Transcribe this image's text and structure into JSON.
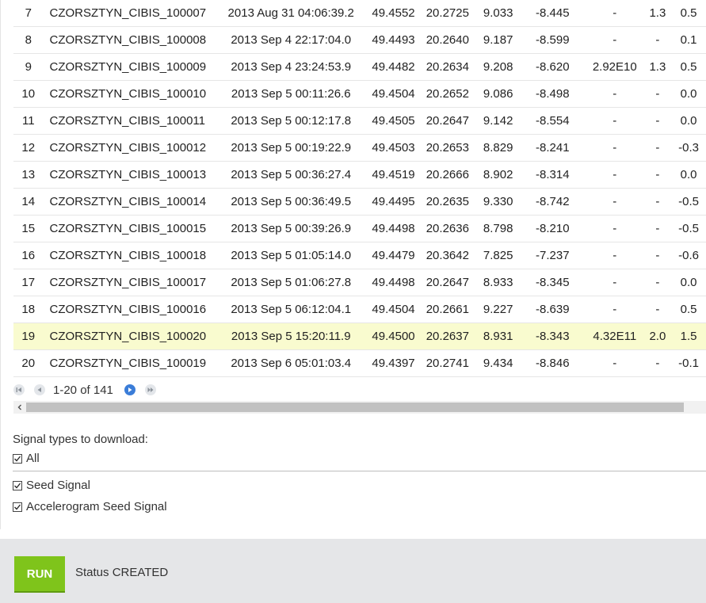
{
  "table": {
    "rows": [
      {
        "no": "7",
        "name": "CZORSZTYN_CIBIS_100007",
        "date": "2013 Aug 31 04:06:39.2",
        "lat": "49.4552",
        "lon": "20.2725",
        "v1": "9.033",
        "v2": "-8.445",
        "v3": "-",
        "v4": "1.3",
        "v5": "0.5",
        "highlight": false
      },
      {
        "no": "8",
        "name": "CZORSZTYN_CIBIS_100008",
        "date": "2013 Sep 4 22:17:04.0",
        "lat": "49.4493",
        "lon": "20.2640",
        "v1": "9.187",
        "v2": "-8.599",
        "v3": "-",
        "v4": "-",
        "v5": "0.1",
        "highlight": false
      },
      {
        "no": "9",
        "name": "CZORSZTYN_CIBIS_100009",
        "date": "2013 Sep 4 23:24:53.9",
        "lat": "49.4482",
        "lon": "20.2634",
        "v1": "9.208",
        "v2": "-8.620",
        "v3": "2.92E10",
        "v4": "1.3",
        "v5": "0.5",
        "highlight": false
      },
      {
        "no": "10",
        "name": "CZORSZTYN_CIBIS_100010",
        "date": "2013 Sep 5 00:11:26.6",
        "lat": "49.4504",
        "lon": "20.2652",
        "v1": "9.086",
        "v2": "-8.498",
        "v3": "-",
        "v4": "-",
        "v5": "0.0",
        "highlight": false
      },
      {
        "no": "11",
        "name": "CZORSZTYN_CIBIS_100011",
        "date": "2013 Sep 5 00:12:17.8",
        "lat": "49.4505",
        "lon": "20.2647",
        "v1": "9.142",
        "v2": "-8.554",
        "v3": "-",
        "v4": "-",
        "v5": "0.0",
        "highlight": false
      },
      {
        "no": "12",
        "name": "CZORSZTYN_CIBIS_100012",
        "date": "2013 Sep 5 00:19:22.9",
        "lat": "49.4503",
        "lon": "20.2653",
        "v1": "8.829",
        "v2": "-8.241",
        "v3": "-",
        "v4": "-",
        "v5": "-0.3",
        "highlight": false
      },
      {
        "no": "13",
        "name": "CZORSZTYN_CIBIS_100013",
        "date": "2013 Sep 5 00:36:27.4",
        "lat": "49.4519",
        "lon": "20.2666",
        "v1": "8.902",
        "v2": "-8.314",
        "v3": "-",
        "v4": "-",
        "v5": "0.0",
        "highlight": false
      },
      {
        "no": "14",
        "name": "CZORSZTYN_CIBIS_100014",
        "date": "2013 Sep 5 00:36:49.5",
        "lat": "49.4495",
        "lon": "20.2635",
        "v1": "9.330",
        "v2": "-8.742",
        "v3": "-",
        "v4": "-",
        "v5": "-0.5",
        "highlight": false
      },
      {
        "no": "15",
        "name": "CZORSZTYN_CIBIS_100015",
        "date": "2013 Sep 5 00:39:26.9",
        "lat": "49.4498",
        "lon": "20.2636",
        "v1": "8.798",
        "v2": "-8.210",
        "v3": "-",
        "v4": "-",
        "v5": "-0.5",
        "highlight": false
      },
      {
        "no": "16",
        "name": "CZORSZTYN_CIBIS_100018",
        "date": "2013 Sep 5 01:05:14.0",
        "lat": "49.4479",
        "lon": "20.3642",
        "v1": "7.825",
        "v2": "-7.237",
        "v3": "-",
        "v4": "-",
        "v5": "-0.6",
        "highlight": false
      },
      {
        "no": "17",
        "name": "CZORSZTYN_CIBIS_100017",
        "date": "2013 Sep 5 01:06:27.8",
        "lat": "49.4498",
        "lon": "20.2647",
        "v1": "8.933",
        "v2": "-8.345",
        "v3": "-",
        "v4": "-",
        "v5": "0.0",
        "highlight": false
      },
      {
        "no": "18",
        "name": "CZORSZTYN_CIBIS_100016",
        "date": "2013 Sep 5 06:12:04.1",
        "lat": "49.4504",
        "lon": "20.2661",
        "v1": "9.227",
        "v2": "-8.639",
        "v3": "-",
        "v4": "-",
        "v5": "0.5",
        "highlight": false
      },
      {
        "no": "19",
        "name": "CZORSZTYN_CIBIS_100020",
        "date": "2013 Sep 5 15:20:11.9",
        "lat": "49.4500",
        "lon": "20.2637",
        "v1": "8.931",
        "v2": "-8.343",
        "v3": "4.32E11",
        "v4": "2.0",
        "v5": "1.5",
        "highlight": true
      },
      {
        "no": "20",
        "name": "CZORSZTYN_CIBIS_100019",
        "date": "2013 Sep 6 05:01:03.4",
        "lat": "49.4397",
        "lon": "20.2741",
        "v1": "9.434",
        "v2": "-8.846",
        "v3": "-",
        "v4": "-",
        "v5": "-0.1",
        "highlight": false
      }
    ]
  },
  "pagination": {
    "range_text": "1-20 of 141"
  },
  "signals": {
    "title": "Signal types to download:",
    "all_label": "All",
    "all_checked": true,
    "options": [
      {
        "label": "Seed Signal",
        "checked": true
      },
      {
        "label": "Accelerogram Seed Signal",
        "checked": true
      }
    ]
  },
  "footer": {
    "run_label": "RUN",
    "status_text": "Status CREATED"
  },
  "colors": {
    "highlight_row": "#f9fbcf",
    "run_button": "#7fc41b",
    "pager_active": "#3b7dd8",
    "footer_bg": "#e5e6e8"
  },
  "icons": {
    "pager": [
      "first-page-icon",
      "prev-page-icon",
      "next-page-icon",
      "last-page-icon"
    ],
    "scroll": "scroll-left-icon",
    "checkbox": "checkmark-icon"
  }
}
